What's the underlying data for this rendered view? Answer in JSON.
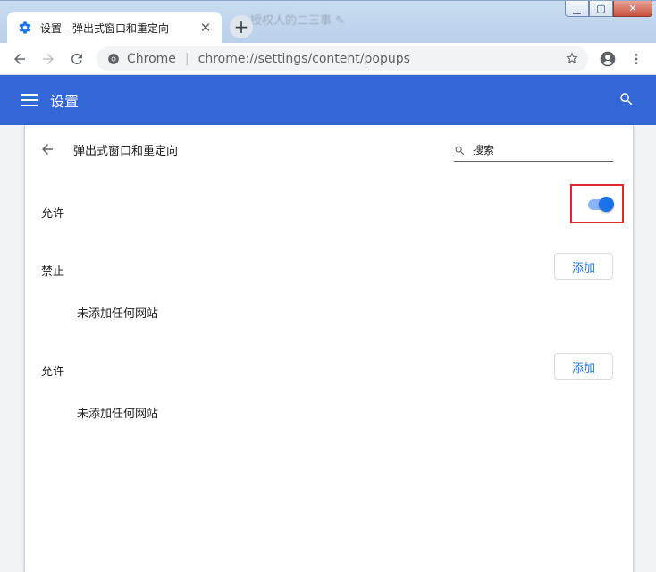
{
  "window": {
    "tab_title": "设置 - 弹出式窗口和重定向",
    "tab_close": "✕",
    "background_text": "授权人的二三事 ✎",
    "new_tab": "+",
    "buttons": [
      "▁",
      "▢",
      "✕"
    ]
  },
  "toolbar": {
    "site_name": "Chrome",
    "separator": "|",
    "url": "chrome://settings/content/popups"
  },
  "header": {
    "title": "设置"
  },
  "subpage": {
    "title": "弹出式窗口和重定向",
    "search_placeholder": "搜索"
  },
  "main_toggle": {
    "label": "允许",
    "enabled": true
  },
  "sections": [
    {
      "label": "禁止",
      "add_label": "添加",
      "empty_text": "未添加任何网站"
    },
    {
      "label": "允许",
      "add_label": "添加",
      "empty_text": "未添加任何网站"
    }
  ],
  "colors": {
    "header": "#3367d6",
    "accent": "#1a73e8",
    "highlight_box": "#e0292c"
  }
}
